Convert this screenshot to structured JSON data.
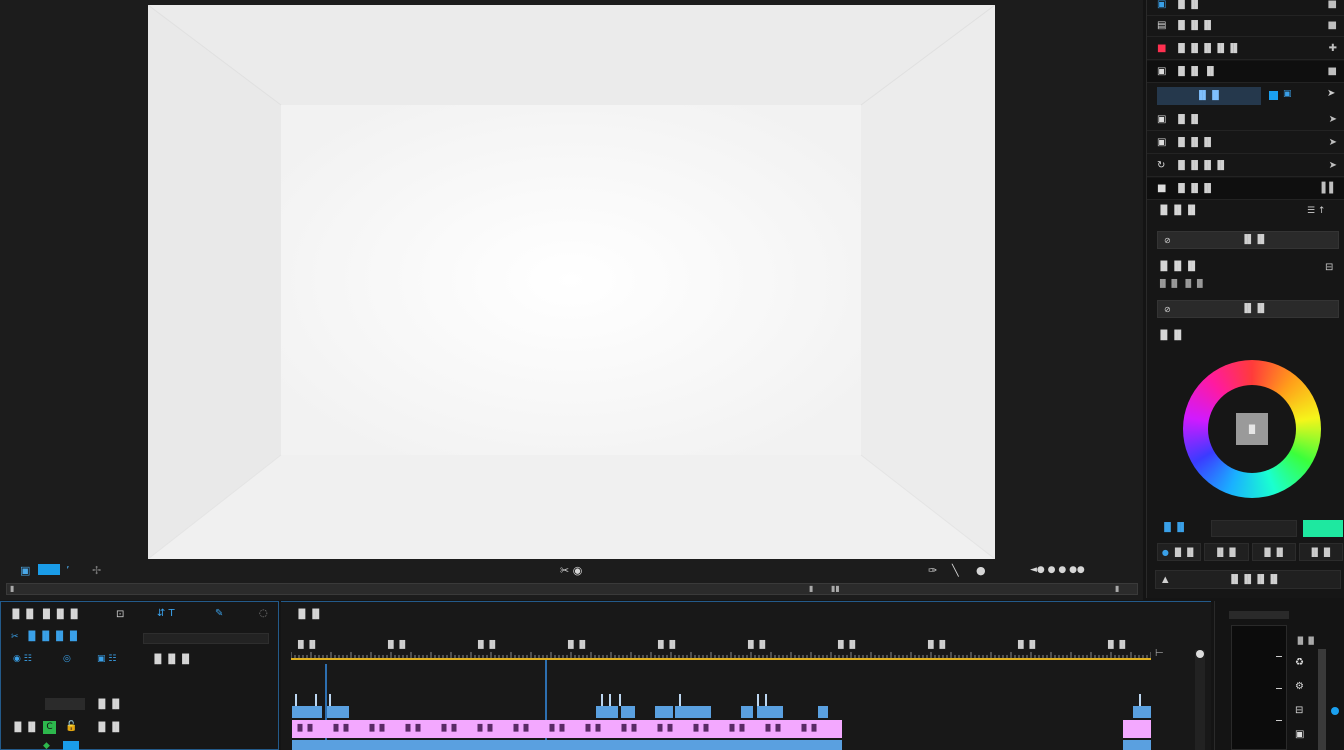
{
  "monitor": {
    "timecode_left": "",
    "controls_center": "✂ ◉",
    "controls_right": "◄● ● ● ●●"
  },
  "right_panel": {
    "rows": [
      {
        "icon": "▣",
        "label": "▐▌▐▌",
        "arrow": "■"
      },
      {
        "icon": "▤",
        "label": "▐▌▐▌▐▌",
        "arrow": "■"
      },
      {
        "icon": "■",
        "label": "▐▌▐▌▐▌▐▌▐▌",
        "arrow": "✚"
      },
      {
        "icon": "▣",
        "label": "▐▌▐▌ ▐▌",
        "arrow": "■"
      },
      {
        "icon": "▣",
        "label": "▐▌▐▌",
        "arrow": "➤"
      },
      {
        "icon": "▣",
        "label": "▐▌▐▌▐▌",
        "arrow": "➤"
      },
      {
        "icon": "↻",
        "label": "▐▌▐▌▐▌▐▌",
        "arrow": "➤"
      },
      {
        "icon": "■",
        "label": "▐▌▐▌▐▌",
        "arrow": "▌▌"
      }
    ],
    "tab_selected": "▐▌▐▌",
    "section1_label": "▐▌▐▌▐▌",
    "section2_label": "▐▌▐▌▐▌",
    "section2_sub": "▐▌▐▌ ▐▌▐▌",
    "section3_label": "▐▌▐▌",
    "button1": "▐▌▐▌",
    "button2": "▐▌▐▌",
    "wheel_center": "▐▌",
    "bottom_label": "▐▌▐▌",
    "bottom_btns": [
      "▐▌▐▌",
      "▐▌▐▌",
      "▐▌▐▌",
      "▐▌▐▌"
    ],
    "footer": "▐▌▐▌▐▌▐▌",
    "accent_green": "#1ee8a0",
    "accent_blue": "#1aa0f0"
  },
  "left_panel": {
    "title": "▐▌▐▌ ▐▌▐▌▐▌",
    "subtitle": "▐▌▐▌▐▌▐▌",
    "line3": "▐▌▐▌▐▌",
    "line4": "▐▌▐▌",
    "line5": "▐▌▐▌",
    "line6": "▐▌▐▌"
  },
  "timeline": {
    "title": "▐▌▐▌",
    "ruler_labels": [
      "▐▌▐▌",
      "▐▌▐▌",
      "▐▌▐▌",
      "▐▌▐▌",
      "▐▌▐▌",
      "▐▌▐▌",
      "▐▌▐▌",
      "▐▌▐▌",
      "▐▌▐▌",
      "▐▌▐▌"
    ],
    "clip_pink_color": "#f3a8ff",
    "clip_blue_color": "#5aa0e0",
    "ruler_color": "#e0b020"
  },
  "meters": {
    "label": "▐▌▐▌"
  }
}
